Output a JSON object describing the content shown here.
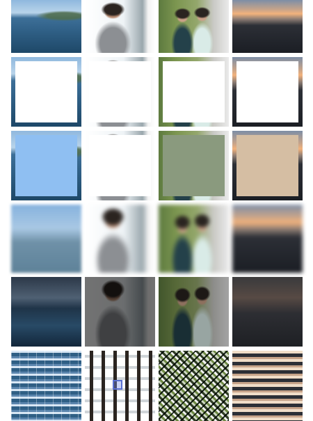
{
  "screen": "filter-preview-grid",
  "rows": [
    {
      "filter": "original",
      "tiles": [
        "bay",
        "woman",
        "couple",
        "sunset"
      ]
    },
    {
      "filter": "white-frame",
      "tiles": [
        "bay",
        "woman",
        "couple",
        "sunset"
      ]
    },
    {
      "filter": "color-frame",
      "tiles": [
        "bay",
        "woman",
        "couple",
        "sunset"
      ]
    },
    {
      "filter": "blur",
      "tiles": [
        "bay",
        "woman",
        "couple",
        "sunset"
      ]
    },
    {
      "filter": "darken",
      "tiles": [
        "bay",
        "woman",
        "couple",
        "sunset"
      ]
    },
    {
      "filter": "tiled-pattern",
      "tiles": [
        "bay",
        "woman",
        "couple",
        "sunset"
      ]
    }
  ],
  "frame_colors": [
    "#8fbff2",
    "#ffffff",
    "#8a9a7e",
    "#d5bea3"
  ]
}
